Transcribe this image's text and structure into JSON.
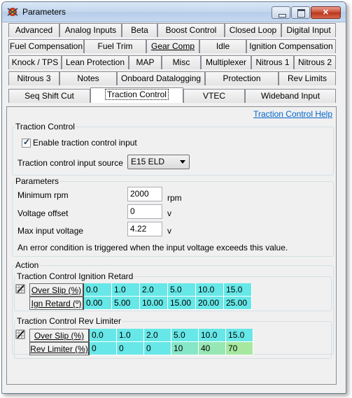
{
  "window": {
    "title": "Parameters"
  },
  "tabs": {
    "row1": [
      "Advanced",
      "Analog Inputs",
      "Beta",
      "Boost Control",
      "Closed Loop",
      "Digital Input"
    ],
    "row2": [
      "Fuel Compensation",
      "Fuel Trim",
      "Gear Comp",
      "Idle",
      "Ignition Compensation"
    ],
    "row3": [
      "Knock / TPS",
      "Lean Protection",
      "MAP",
      "Misc",
      "Multiplexer",
      "Nitrous 1",
      "Nitrous 2"
    ],
    "row4": [
      "Nitrous 3",
      "Notes",
      "Onboard Datalogging",
      "Protection",
      "Rev Limits"
    ],
    "row5": [
      "Seq Shift Cut",
      "Traction Control",
      "VTEC",
      "Wideband Input"
    ],
    "active": "Traction Control"
  },
  "panel": {
    "help_link": "Traction Control Help",
    "traction_group": {
      "label": "Traction Control",
      "enable_label": "Enable traction control input",
      "enabled": true,
      "source_label": "Traction control input source",
      "source_value": "E15 ELD"
    },
    "parameters_group": {
      "label": "Parameters",
      "min_rpm_label": "Minimum rpm",
      "min_rpm_value": "2000",
      "min_rpm_unit": "rpm",
      "voltage_offset_label": "Voltage offset",
      "voltage_offset_value": "0",
      "voltage_offset_unit": "v",
      "max_voltage_label": "Max input voltage",
      "max_voltage_value": "4.22",
      "max_voltage_unit": "v",
      "note": "An error condition is triggered when the input voltage exceeds this value."
    },
    "action_group": {
      "label": "Action",
      "ign_retard": {
        "label": "Traction Control Ignition Retard",
        "row1_header": "Over Slip (%)",
        "row1": [
          "0.0",
          "1.0",
          "2.0",
          "5.0",
          "10.0",
          "15.0"
        ],
        "row2_header": "Ign Retard (º)",
        "row2": [
          "0.00",
          "5.00",
          "10.00",
          "15.00",
          "20.00",
          "25.00"
        ]
      },
      "rev_limiter": {
        "label": "Traction Control Rev Limiter",
        "row1_header": "Over Slip (%)",
        "row1": [
          "0.0",
          "1.0",
          "2.0",
          "5.0",
          "10.0",
          "15.0"
        ],
        "row2_header": "Rev Limiter (%)",
        "row2": [
          "0",
          "0",
          "0",
          "10",
          "40",
          "70"
        ]
      }
    }
  },
  "colors": {
    "cell_cyan": "#67e7e7",
    "cell_green": "#a6e8a0",
    "link": "#0066cc"
  }
}
